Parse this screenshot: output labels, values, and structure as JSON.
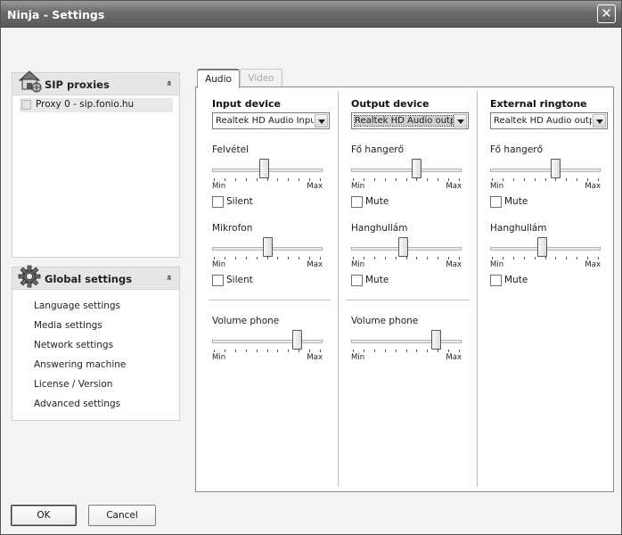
{
  "window": {
    "title": "Ninja - Settings",
    "close_glyph": "✕"
  },
  "sip_panel": {
    "title": "SIP proxies",
    "collapse_glyph": "»",
    "icon": "house-network-icon",
    "proxies": [
      {
        "label": "Proxy 0 -  sip.fonio.hu"
      }
    ]
  },
  "global_panel": {
    "title": "Global settings",
    "collapse_glyph": "»",
    "icon": "gear-icon",
    "items": [
      "Language settings",
      "Media settings",
      "Network settings",
      "Answering machine",
      "License / Version",
      "Advanced settings"
    ]
  },
  "tabs": [
    {
      "label": "Audio",
      "active": true
    },
    {
      "label": "Video",
      "active": false
    }
  ],
  "audio": {
    "input": {
      "title": "Input device",
      "device": "Realtek HD Audio Inpu",
      "slider1": {
        "label": "Felvétel",
        "level": 0.47,
        "min": "Min",
        "max": "Max"
      },
      "check1": {
        "label": "Silent",
        "checked": false
      },
      "slider2": {
        "label": "Mikrofon",
        "level": 0.5,
        "min": "Min",
        "max": "Max"
      },
      "check2": {
        "label": "Silent",
        "checked": false
      }
    },
    "output": {
      "title": "Output device",
      "device": "Realtek HD Audio outp",
      "slider1": {
        "label": "Fő hangerő",
        "level": 0.6,
        "min": "Min",
        "max": "Max"
      },
      "check1": {
        "label": "Mute",
        "checked": false
      },
      "slider2": {
        "label": "Hanghullám",
        "level": 0.47,
        "min": "Min",
        "max": "Max"
      },
      "check2": {
        "label": "Mute",
        "checked": false
      }
    },
    "ringtone": {
      "title": "External ringtone",
      "device": "Realtek HD Audio outp",
      "slider1": {
        "label": "Fő hangerő",
        "level": 0.6,
        "min": "Min",
        "max": "Max"
      },
      "check1": {
        "label": "Mute",
        "checked": false
      },
      "slider2": {
        "label": "Hanghullám",
        "level": 0.47,
        "min": "Min",
        "max": "Max"
      },
      "check2": {
        "label": "Mute",
        "checked": false
      }
    },
    "volume_phone_input": {
      "label": "Volume phone",
      "level": 0.8,
      "min": "Min",
      "max": "Max"
    },
    "volume_phone_output": {
      "label": "Volume phone",
      "level": 0.8,
      "min": "Min",
      "max": "Max"
    }
  },
  "buttons": {
    "ok": "OK",
    "cancel": "Cancel"
  }
}
